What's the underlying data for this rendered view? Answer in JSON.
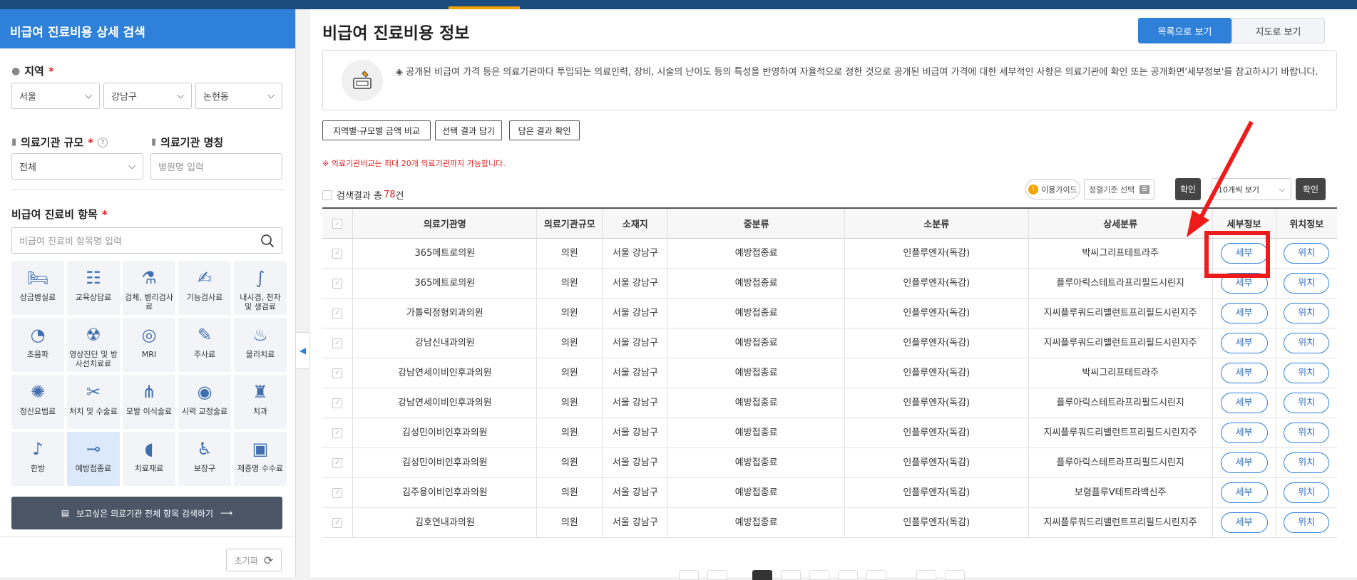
{
  "sidebar": {
    "title": "비급여 진료비용 상세 검색",
    "region_label": "지역",
    "region": {
      "city": "서울",
      "district": "강남구",
      "dong": "논현동"
    },
    "scale_label": "의료기관 규모",
    "scale_value": "전체",
    "name_label": "의료기관 명칭",
    "name_placeholder": "병원명 입력",
    "items_label": "비급여 진료비 항목",
    "items_placeholder": "비급여 진료비 항목명 입력",
    "categories": [
      {
        "label": "상급병실료",
        "icon": "hospital-bed-icon"
      },
      {
        "label": "교육상담료",
        "icon": "consultation-icon"
      },
      {
        "label": "검체, 병리검사료",
        "icon": "lab-test-icon"
      },
      {
        "label": "기능검사료",
        "icon": "function-test-icon"
      },
      {
        "label": "내시경, 천자 및 생검료",
        "icon": "endoscope-icon"
      },
      {
        "label": "초음파",
        "icon": "ultrasound-icon"
      },
      {
        "label": "영상진단 및 방사선치료료",
        "icon": "radiology-icon"
      },
      {
        "label": "MRI",
        "icon": "mri-icon"
      },
      {
        "label": "주사료",
        "icon": "syringe-icon"
      },
      {
        "label": "물리치료",
        "icon": "physical-therapy-icon"
      },
      {
        "label": "정신요법료",
        "icon": "brain-icon"
      },
      {
        "label": "처치 및 수술료",
        "icon": "surgery-icon"
      },
      {
        "label": "모발 이식술료",
        "icon": "hair-icon"
      },
      {
        "label": "시력 교정술료",
        "icon": "eye-icon"
      },
      {
        "label": "치과",
        "icon": "tooth-icon"
      },
      {
        "label": "한방",
        "icon": "acupuncture-icon"
      },
      {
        "label": "예방접종료",
        "icon": "vaccine-icon",
        "selected": true
      },
      {
        "label": "치료재료",
        "icon": "material-icon"
      },
      {
        "label": "보장구",
        "icon": "wheelchair-icon"
      },
      {
        "label": "제증명 수수료",
        "icon": "certificate-icon"
      }
    ],
    "search_all_label": "보고싶은 의료기관 전체 항목 검색하기",
    "reset_label": "초기화"
  },
  "main": {
    "title": "비급여 진료비용 정보",
    "view_list": "목록으로 보기",
    "view_map": "지도로 보기",
    "notice": "◈ 공개된 비급여 가격 등은 의료기관마다 투입되는 의료인력, 장비, 시술의 난이도 등의 특성을 반영하여 자율적으로 정한 것으로 공개된 비급여 가격에 대한 세부적인 사항은 의료기관에 확인 또는 공개화면'세부정보'를 참고하시기 바랍니다.",
    "btn_compare": "지역별·규모별 금액 비교",
    "btn_add": "선택 결과 담기",
    "btn_check": "담은 결과 확인",
    "warning": "※ 의료기관비교는 최대 20개 의료기관까지 가능합니다.",
    "count_prefix": "검색결과 총",
    "count_value": "78",
    "count_suffix": "건",
    "guide_label": "이용가이드",
    "sort_label": "정렬기준 선택",
    "confirm_label": "확인",
    "page_size": "10개씩 보기",
    "columns": [
      "의료기관명",
      "의료기관규모",
      "소재지",
      "중분류",
      "소분류",
      "상세분류",
      "세부정보",
      "위치정보"
    ],
    "detail_btn": "세부",
    "location_btn": "위치",
    "rows": [
      {
        "name": "365메트로의원",
        "scale": "의원",
        "loc": "서울 강남구",
        "mid": "예방접종료",
        "sub": "인플루엔자(독감)",
        "detail": "박씨그리프테트라주"
      },
      {
        "name": "365메트로의원",
        "scale": "의원",
        "loc": "서울 강남구",
        "mid": "예방접종료",
        "sub": "인플루엔자(독감)",
        "detail": "플루아릭스테트라프리필드시린지"
      },
      {
        "name": "가톨릭정형외과의원",
        "scale": "의원",
        "loc": "서울 강남구",
        "mid": "예방접종료",
        "sub": "인플루엔자(독감)",
        "detail": "지씨플루쿼드리밸런트프리필드시린지주"
      },
      {
        "name": "강남신내과의원",
        "scale": "의원",
        "loc": "서울 강남구",
        "mid": "예방접종료",
        "sub": "인플루엔자(독감)",
        "detail": "지씨플루쿼드리밸런트프리필드시린지주"
      },
      {
        "name": "강남연세이비인후과의원",
        "scale": "의원",
        "loc": "서울 강남구",
        "mid": "예방접종료",
        "sub": "인플루엔자(독감)",
        "detail": "박씨그리프테트라주"
      },
      {
        "name": "강남연세이비인후과의원",
        "scale": "의원",
        "loc": "서울 강남구",
        "mid": "예방접종료",
        "sub": "인플루엔자(독감)",
        "detail": "플루아릭스테트라프리필드시린지"
      },
      {
        "name": "김성민이비인후과의원",
        "scale": "의원",
        "loc": "서울 강남구",
        "mid": "예방접종료",
        "sub": "인플루엔자(독감)",
        "detail": "지씨플루쿼드리밸런트프리필드시린지주"
      },
      {
        "name": "김성민이비인후과의원",
        "scale": "의원",
        "loc": "서울 강남구",
        "mid": "예방접종료",
        "sub": "인플루엔자(독감)",
        "detail": "플루아릭스테트라프리필드시린지"
      },
      {
        "name": "김주용이비인후과의원",
        "scale": "의원",
        "loc": "서울 강남구",
        "mid": "예방접종료",
        "sub": "인플루엔자(독감)",
        "detail": "보령플루Ⅴ테트라백신주"
      },
      {
        "name": "김호연내과의원",
        "scale": "의원",
        "loc": "서울 강남구",
        "mid": "예방접종료",
        "sub": "인플루엔자(독감)",
        "detail": "지씨플루쿼드리밸런트프리필드시린지주"
      }
    ]
  },
  "colors": {
    "primary": "#2f80d9",
    "header_bar": "#1b4a7d",
    "accent_red": "#ee1b1b",
    "dark_button": "#4a5566"
  }
}
